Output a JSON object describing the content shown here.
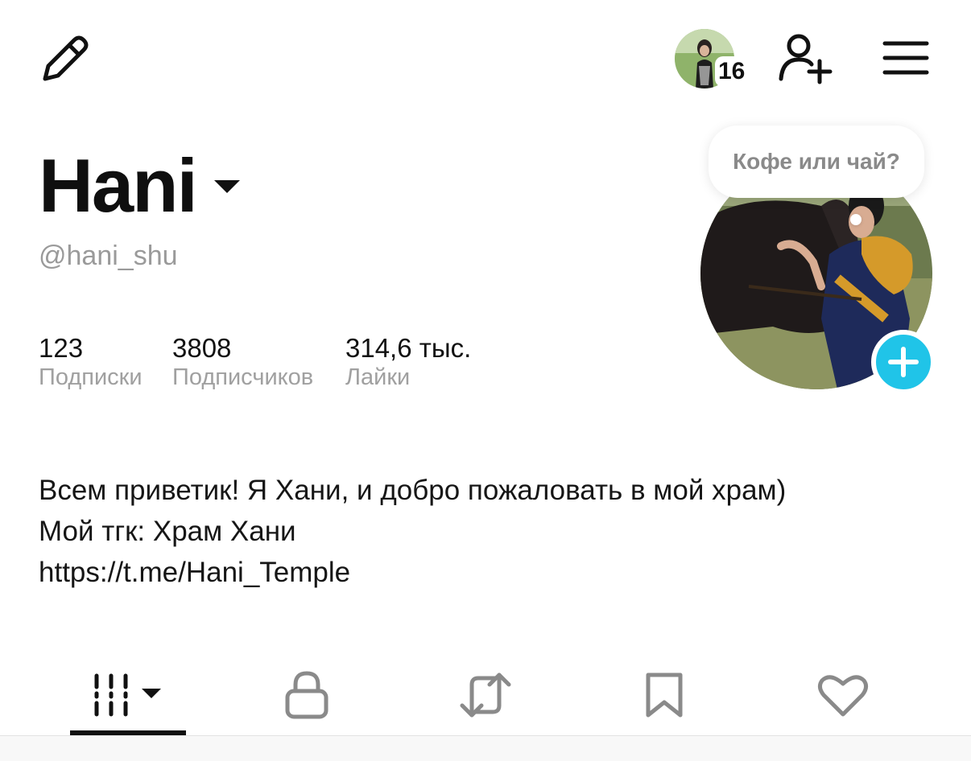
{
  "header": {
    "story_count": "16"
  },
  "profile": {
    "display_name": "Hani",
    "username": "@hani_shu",
    "note": "Кофе или чай?"
  },
  "stats": [
    {
      "value": "123",
      "label": "Подписки"
    },
    {
      "value": "3808",
      "label": "Подписчиков"
    },
    {
      "value": "314,6 тыс.",
      "label": "Лайки"
    }
  ],
  "bio": {
    "line1": "Всем приветик! Я Хани, и добро пожаловать в мой храм)",
    "line2": "Мой тгк: Храм Хани",
    "link": "https://t.me/Hani_Temple"
  },
  "tabs": [
    {
      "icon": "videos-grid-icon",
      "active": true
    },
    {
      "icon": "lock-icon",
      "active": false
    },
    {
      "icon": "repost-icon",
      "active": false
    },
    {
      "icon": "bookmark-icon",
      "active": false
    },
    {
      "icon": "heart-icon",
      "active": false
    }
  ],
  "colors": {
    "accent": "#20c4e8",
    "text": "#111111",
    "muted": "#a0a0a0"
  }
}
